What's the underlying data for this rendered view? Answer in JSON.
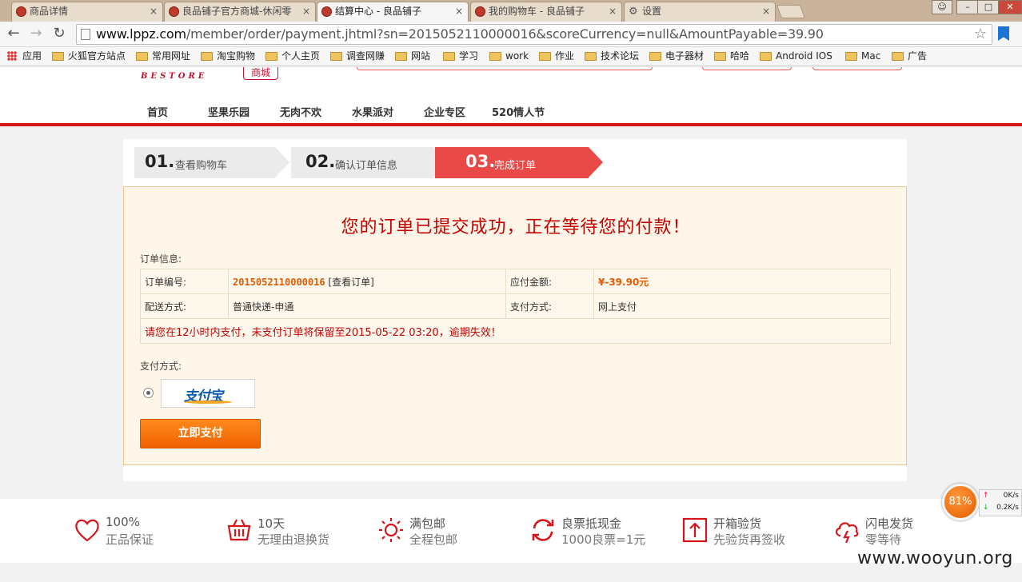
{
  "browser": {
    "tabs": [
      {
        "title": "商品详情"
      },
      {
        "title": "良品铺子官方商城-休闲零"
      },
      {
        "title": "结算中心 - 良品铺子"
      },
      {
        "title": "我的购物车 - 良品铺子"
      },
      {
        "title": "设置"
      }
    ],
    "close_glyph": "×",
    "url_domain": "www.lppz.com",
    "url_rest": "/member/order/payment.jhtml?sn=2015052110000016&scoreCurrency=null&AmountPayable=39.90",
    "bookmarks": [
      "应用",
      "火狐官方站点",
      "常用网址",
      "淘宝购物",
      "个人主页",
      "调查网赚",
      "网站",
      "学习",
      "work",
      "作业",
      "技术论坛",
      "电子器材",
      "哈哈",
      "Android IOS",
      "Mac",
      "广告"
    ]
  },
  "header": {
    "logo_sub": "BESTORE",
    "logo_badge": "商城",
    "nav": [
      "首页",
      "坚果乐园",
      "无肉不欢",
      "水果派对",
      "企业专区",
      "520情人节"
    ]
  },
  "steps": [
    {
      "num": "01.",
      "label": "查看购物车"
    },
    {
      "num": "02.",
      "label": "确认订单信息"
    },
    {
      "num": "03.",
      "label": "完成订单"
    }
  ],
  "order": {
    "success_title": "您的订单已提交成功，正在等待您的付款！",
    "info_label": "订单信息:",
    "order_no_label": "订单编号:",
    "order_no": "2015052110000016",
    "view_order": "[查看订单]",
    "amount_label": "应付金额:",
    "amount": "¥-39.90元",
    "shipping_label": "配送方式:",
    "shipping": "普通快递-申通",
    "pay_method_label": "支付方式:",
    "pay_method": "网上支付",
    "warning": "请您在12小时内支付，未支付订单将保留至2015-05-22 03:20，逾期失效！",
    "payment_label": "支付方式:",
    "alipay_text": "支付宝",
    "pay_button": "立即支付"
  },
  "footer": {
    "features": [
      {
        "icon": "heart-icon",
        "l1": "100%",
        "l2": "正品保证"
      },
      {
        "icon": "basket-icon",
        "l1": "10天",
        "l2": "无理由退换货"
      },
      {
        "icon": "sun-icon",
        "l1": "满包邮",
        "l2": "全程包邮"
      },
      {
        "icon": "refresh-icon",
        "l1": "良票抵现金",
        "l2": "1000良票=1元"
      },
      {
        "icon": "upload-box-icon",
        "l1": "开箱验货",
        "l2": "先验货再签收"
      },
      {
        "icon": "cloud-lightning-icon",
        "l1": "闪电发货",
        "l2": "零等待"
      }
    ]
  },
  "speed": {
    "percent": "81%",
    "up": "0K/s",
    "down": "0.2K/s"
  },
  "watermark": "www.wooyun.org",
  "colors": {
    "brand_red": "#d7141a",
    "accent_orange": "#f06000",
    "step_active": "#ea4a47"
  }
}
